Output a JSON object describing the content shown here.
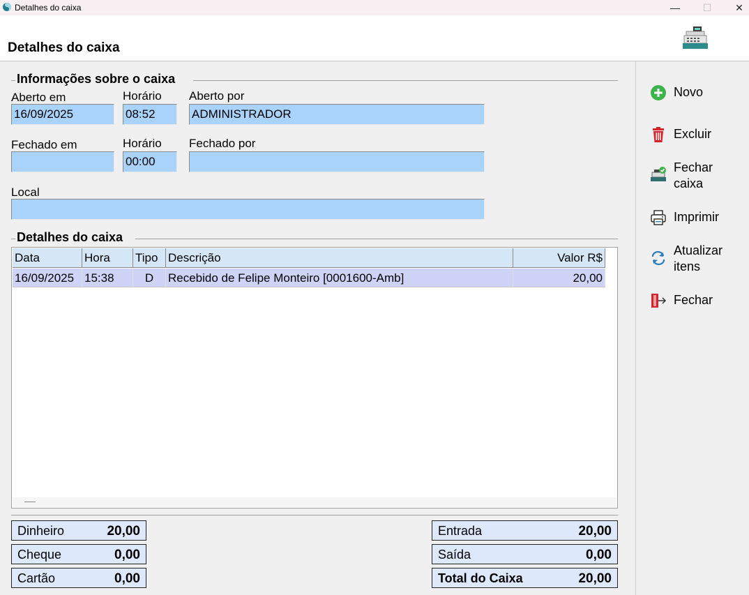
{
  "window": {
    "title": "Detalhes do caixa",
    "minimize": "—",
    "maximize": "☐",
    "close": "✕"
  },
  "header": {
    "title": "Detalhes do caixa"
  },
  "info": {
    "group_title": "Informações sobre o caixa",
    "opened_on_label": "Aberto em",
    "opened_on_value": "16/09/2025",
    "opened_time_label": "Horário",
    "opened_time_value": "08:52",
    "opened_by_label": "Aberto por",
    "opened_by_value": "ADMINISTRADOR",
    "closed_on_label": "Fechado em",
    "closed_on_value": "",
    "closed_time_label": "Horário",
    "closed_time_value": "00:00",
    "closed_by_label": "Fechado por",
    "closed_by_value": "",
    "local_label": "Local",
    "local_value": ""
  },
  "details": {
    "group_title": "Detalhes do caixa",
    "columns": [
      "Data",
      "Hora",
      "Tipo",
      "Descrição",
      "Valor R$"
    ],
    "rows": [
      {
        "data": "16/09/2025",
        "hora": "15:38",
        "tipo": "D",
        "descricao": "Recebido de Felipe Monteiro [0001600-Amb]",
        "valor": "20,00"
      }
    ]
  },
  "totals": {
    "dinheiro_label": "Dinheiro",
    "dinheiro_value": "20,00",
    "cheque_label": "Cheque",
    "cheque_value": "0,00",
    "cartao_label": "Cartão",
    "cartao_value": "0,00",
    "entrada_label": "Entrada",
    "entrada_value": "20,00",
    "saida_label": "Saída",
    "saida_value": "0,00",
    "total_label": "Total do Caixa",
    "total_value": "20,00"
  },
  "sidebar": {
    "novo": "Novo",
    "excluir": "Excluir",
    "fechar_caixa": "Fechar caixa",
    "imprimir": "Imprimir",
    "atualizar": "Atualizar itens",
    "fechar": "Fechar"
  },
  "icons": {
    "app": "app-icon",
    "register": "cash-register-icon",
    "novo": "plus-circle-icon",
    "excluir": "trash-icon",
    "fechar_caixa": "cash-register-check-icon",
    "imprimir": "printer-icon",
    "atualizar": "refresh-icon",
    "fechar": "exit-door-icon"
  },
  "colors": {
    "field_bg": "#a9d3fb",
    "grid_header_bg": "#d5e6f6",
    "grid_row_selected": "#cfd3f7",
    "total_bg": "#dde8fa",
    "novo_green": "#3cb44b",
    "excluir_red": "#d8232a"
  }
}
